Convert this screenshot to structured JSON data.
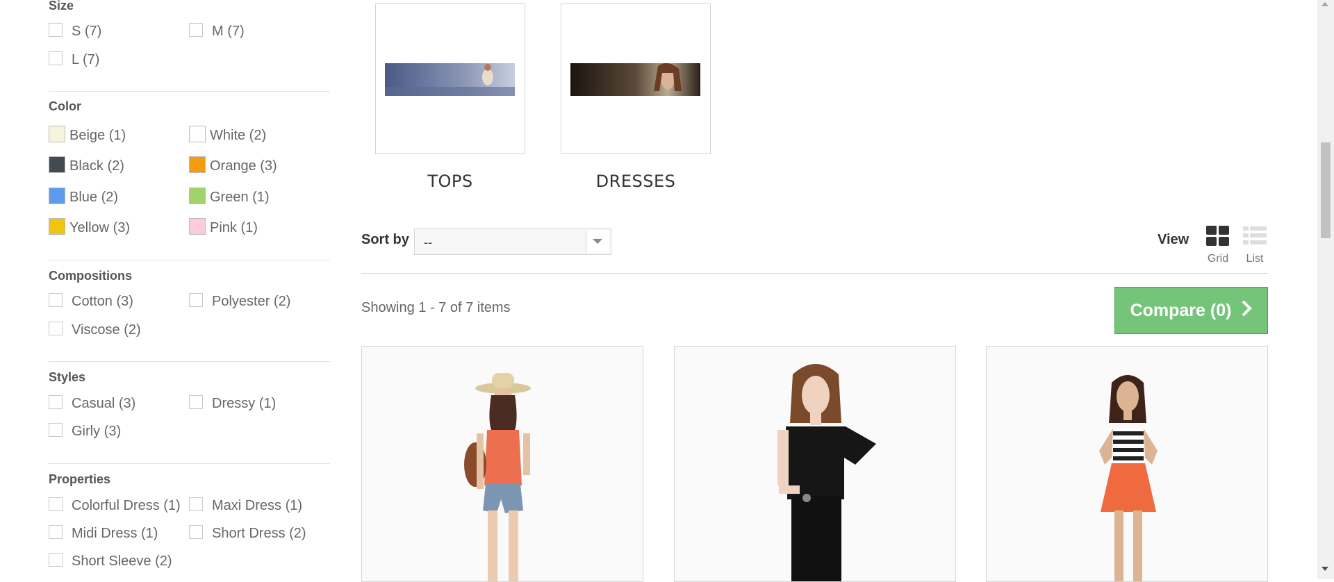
{
  "filters": {
    "size": {
      "title": "Size",
      "options": [
        {
          "label": "S (7)"
        },
        {
          "label": "M (7)"
        },
        {
          "label": "L (7)"
        }
      ]
    },
    "color": {
      "title": "Color",
      "options": [
        {
          "label": "Beige (1)",
          "color": "#f5f5dc"
        },
        {
          "label": "White (2)",
          "color": "#ffffff"
        },
        {
          "label": "Black (2)",
          "color": "#434a54"
        },
        {
          "label": "Orange (3)",
          "color": "#f39c11"
        },
        {
          "label": "Blue (2)",
          "color": "#5d9cec"
        },
        {
          "label": "Green (1)",
          "color": "#a0d468"
        },
        {
          "label": "Yellow (3)",
          "color": "#f1c40f"
        },
        {
          "label": "Pink (1)",
          "color": "#fcccdd"
        }
      ]
    },
    "compositions": {
      "title": "Compositions",
      "options": [
        {
          "label": "Cotton (3)"
        },
        {
          "label": "Polyester (2)"
        },
        {
          "label": "Viscose (2)"
        }
      ]
    },
    "styles": {
      "title": "Styles",
      "options": [
        {
          "label": "Casual (3)"
        },
        {
          "label": "Dressy (1)"
        },
        {
          "label": "Girly (3)"
        }
      ]
    },
    "properties": {
      "title": "Properties",
      "options": [
        {
          "label": "Colorful Dress (1)"
        },
        {
          "label": "Maxi Dress (1)"
        },
        {
          "label": "Midi Dress (1)"
        },
        {
          "label": "Short Dress (2)"
        },
        {
          "label": "Short Sleeve (2)"
        }
      ]
    }
  },
  "subcategories": [
    {
      "name": "TOPS"
    },
    {
      "name": "DRESSES"
    }
  ],
  "sort": {
    "label": "Sort by",
    "value": "--"
  },
  "view": {
    "label": "View",
    "grid_label": "Grid",
    "list_label": "List",
    "active": "grid"
  },
  "showing": "Showing 1 - 7 of 7 items",
  "compare": {
    "label": "Compare (0)",
    "color": "#74c57a"
  },
  "products": [
    {
      "icon": "product-image-orange-top-hat"
    },
    {
      "icon": "product-image-black-blouse"
    },
    {
      "icon": "product-image-striped-top-orange-skirt"
    }
  ]
}
